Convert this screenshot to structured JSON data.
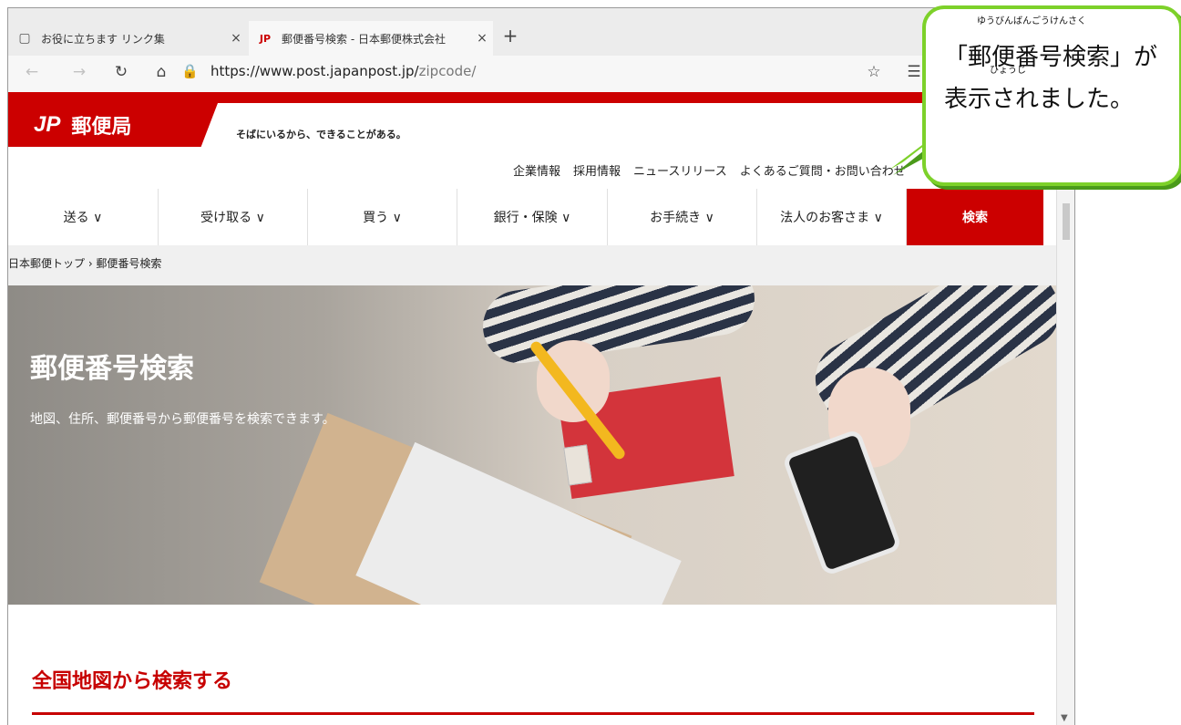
{
  "browser": {
    "tabs": [
      {
        "title": "お役に立ちます リンク集",
        "close": "×"
      },
      {
        "title": "郵便番号検索 - 日本郵便株式会社",
        "close": "×"
      }
    ],
    "new_tab": "+",
    "url_host": "https://www.post.japanpost.jp/",
    "url_path": "zipcode/"
  },
  "site": {
    "logo_jp": "JP",
    "logo_name": "郵便局",
    "tagline": "そばにいるから、できることがある。",
    "utility_links": [
      "企業情報",
      "採用情報",
      "ニュースリリース",
      "よくあるご質問・お問い合わせ"
    ],
    "nav": [
      "送る ∨",
      "受け取る ∨",
      "買う ∨",
      "銀行・保険 ∨",
      "お手続き ∨",
      "法人のお客さま ∨",
      "検索"
    ],
    "breadcrumb": "日本郵便トップ › 郵便番号検索",
    "hero_title": "郵便番号検索",
    "hero_subtitle": "地図、住所、郵便番号から郵便番号を検索できます。",
    "section_title": "全国地図から検索する"
  },
  "callout": {
    "ruby1": "ゆうびんばんごうけんさく",
    "ruby2": "ひょうじ",
    "text": "「郵便番号検索」が表示されました。"
  }
}
